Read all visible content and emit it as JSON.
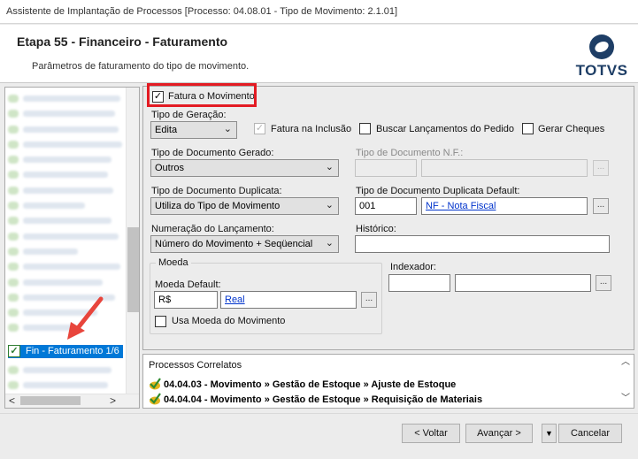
{
  "window": {
    "title": "Assistente de Implantação de Processos [Processo: 04.08.01 - Tipo de Movimento: 2.1.01]"
  },
  "header": {
    "step_title": "Etapa 55 - Financeiro - Faturamento",
    "subtitle": "Parâmetros de faturamento do tipo de movimento.",
    "logo_text": "TOTVS",
    "logo_color": "#1e3e66"
  },
  "tree": {
    "selected_item": "Fin - Faturamento 1/6",
    "selected_checked": true,
    "highlight_color": "#0078d7"
  },
  "form": {
    "fatura_movimento": {
      "label": "Fatura o Movimento",
      "checked": true
    },
    "tipo_geracao": {
      "label": "Tipo de Geração:",
      "value": "Edita"
    },
    "fatura_inclusao": {
      "label": "Fatura na Inclusão",
      "checked": true,
      "enabled": false
    },
    "buscar_lancamentos": {
      "label": "Buscar Lançamentos do Pedido",
      "checked": false
    },
    "gerar_cheques": {
      "label": "Gerar Cheques",
      "checked": false
    },
    "tipo_doc_gerado": {
      "label": "Tipo de Documento Gerado:",
      "value": "Outros"
    },
    "tipo_doc_nf": {
      "label": "Tipo de Documento N.F.:",
      "code": "",
      "description": ""
    },
    "tipo_doc_duplicata": {
      "label": "Tipo de Documento Duplicata:",
      "value": "Utiliza do Tipo de Movimento"
    },
    "tipo_doc_duplicata_default": {
      "label": "Tipo de Documento Duplicata Default:",
      "code": "001",
      "description": "NF - Nota Fiscal"
    },
    "numeracao_lancamento": {
      "label": "Numeração do Lançamento:",
      "value": "Número do Movimento + Seqüencial"
    },
    "historico": {
      "label": "Histórico:",
      "value": ""
    },
    "moeda_group": {
      "label": "Moeda"
    },
    "moeda_default": {
      "label": "Moeda Default:",
      "code": "R$",
      "description": "Real"
    },
    "usa_moeda_movimento": {
      "label": "Usa Moeda do Movimento",
      "checked": false
    },
    "indexador": {
      "label": "Indexador:",
      "code": "",
      "description": ""
    },
    "lookup_button": "..."
  },
  "related": {
    "title": "Processos Correlatos",
    "items": [
      "04.04.03 - Movimento » Gestão de Estoque » Ajuste de Estoque",
      "04.04.04 - Movimento » Gestão de Estoque » Requisição de Materiais"
    ]
  },
  "buttons": {
    "back": "< Voltar",
    "next": "Avançar >",
    "cancel": "Cancelar"
  },
  "annotation": {
    "highlight_color": "#e31b23"
  }
}
